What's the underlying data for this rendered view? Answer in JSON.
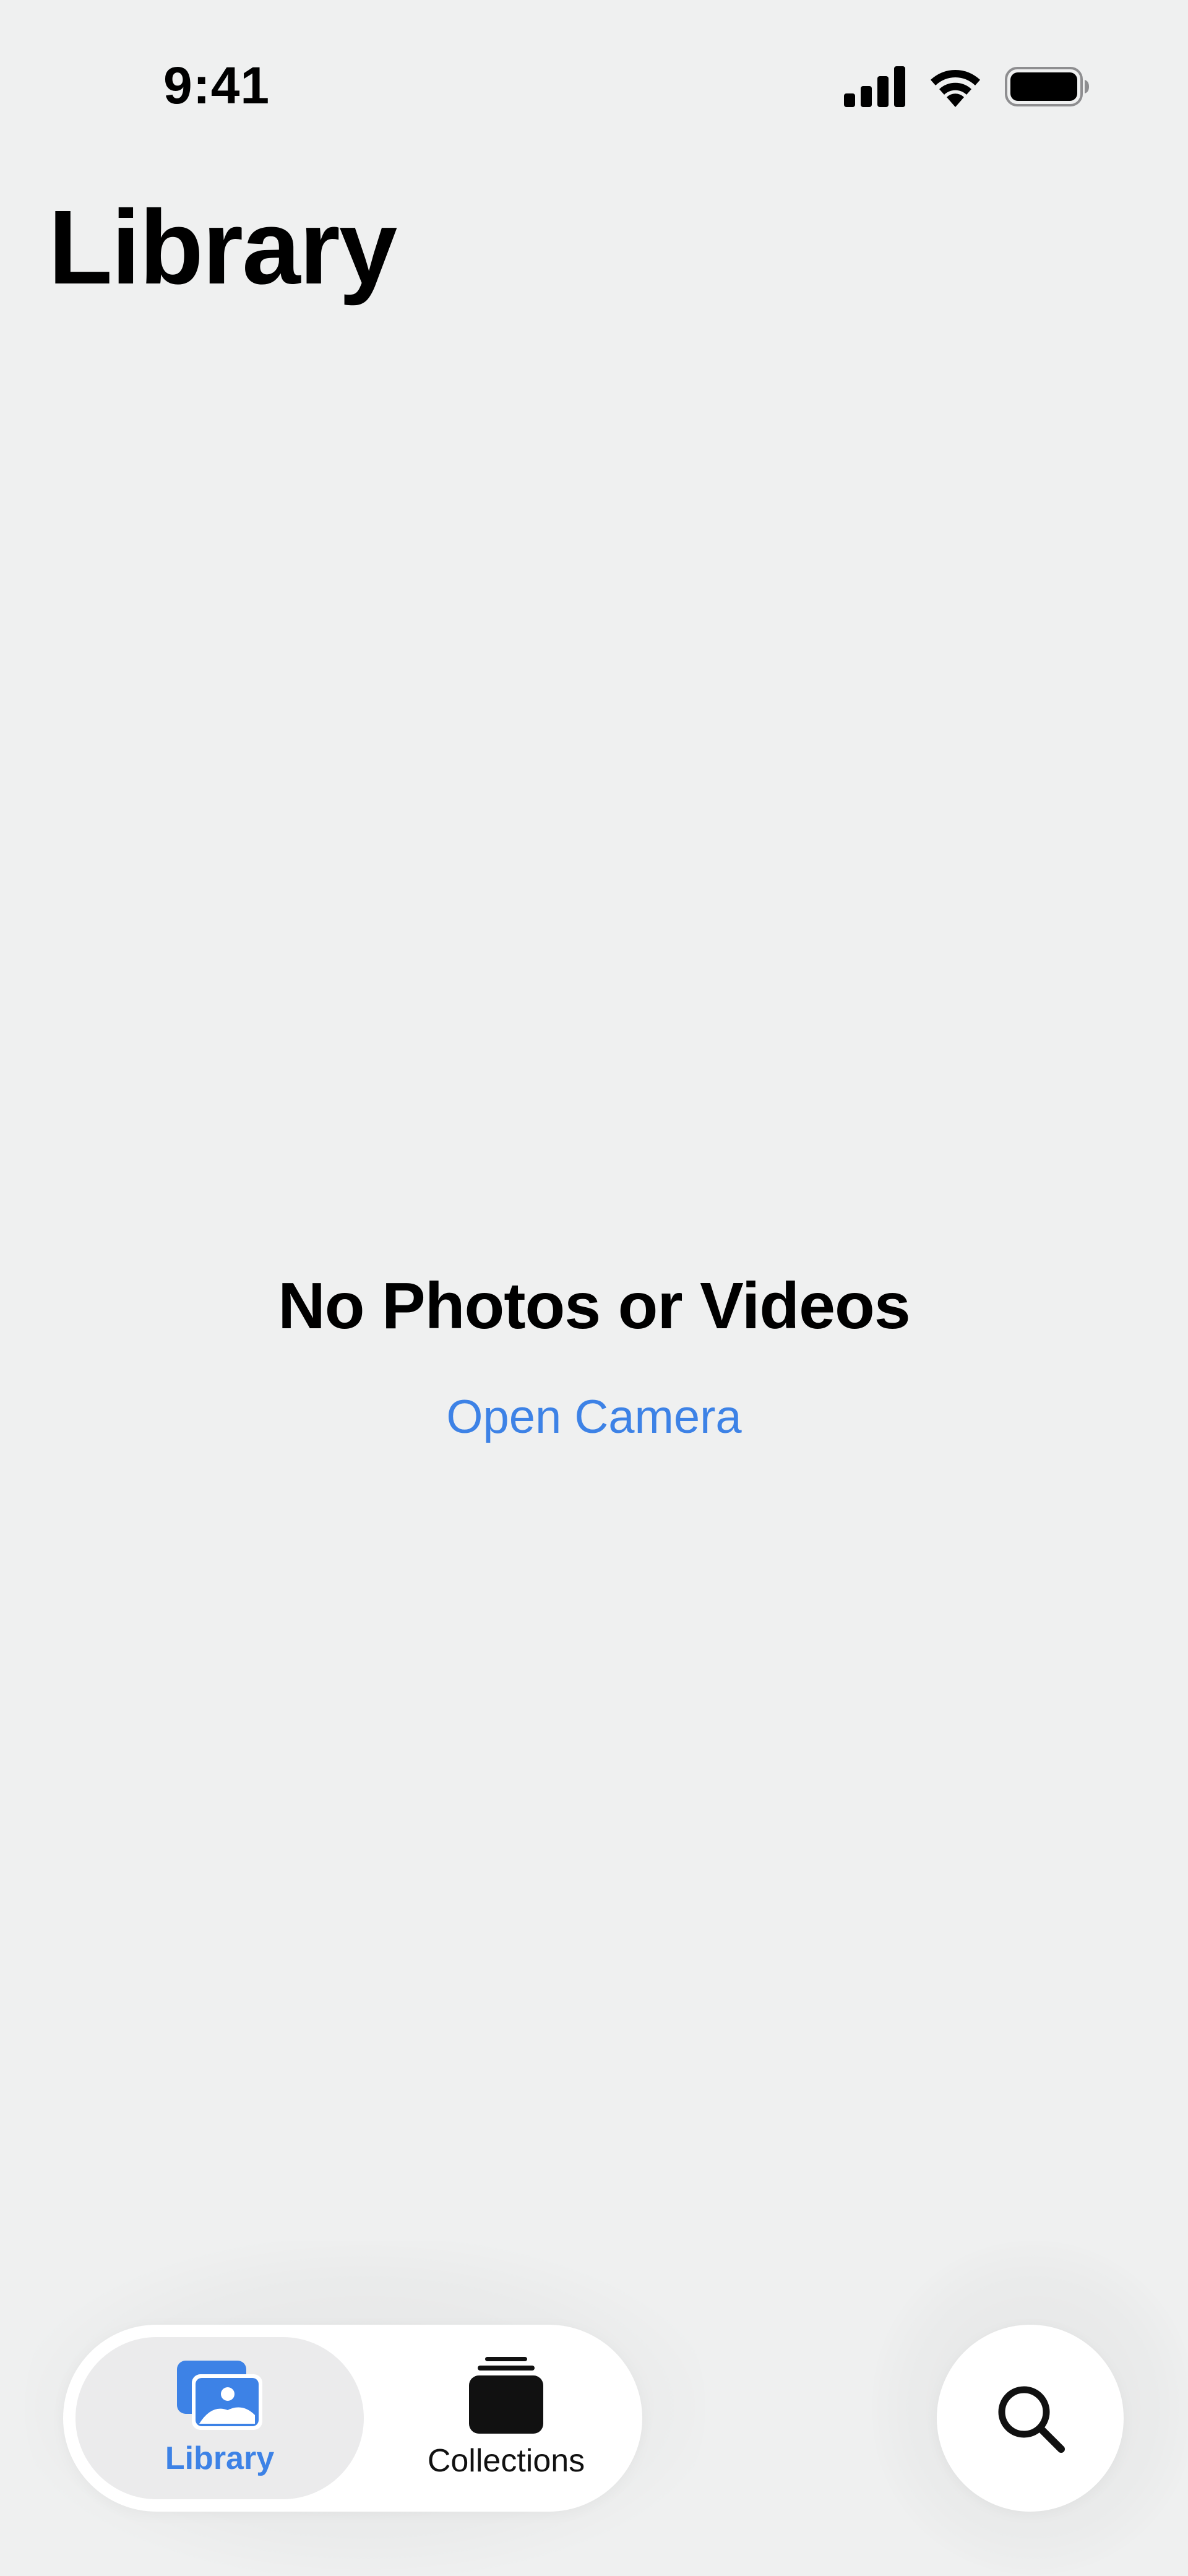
{
  "status_bar": {
    "time": "9:41",
    "icons": [
      "cellular-signal-icon",
      "wifi-icon",
      "battery-icon"
    ]
  },
  "header": {
    "title": "Library"
  },
  "empty_state": {
    "title": "No Photos or Videos",
    "action_label": "Open Camera"
  },
  "tab_bar": {
    "tabs": [
      {
        "label": "Library",
        "icon": "photos-icon",
        "selected": true
      },
      {
        "label": "Collections",
        "icon": "stacked-collections-icon",
        "selected": false
      }
    ],
    "search_icon": "magnifying-glass-icon"
  },
  "colors": {
    "accent": "#3d82e6",
    "background": "#eff0f0",
    "surface": "#ffffff",
    "selected_tab": "#ebebec"
  }
}
